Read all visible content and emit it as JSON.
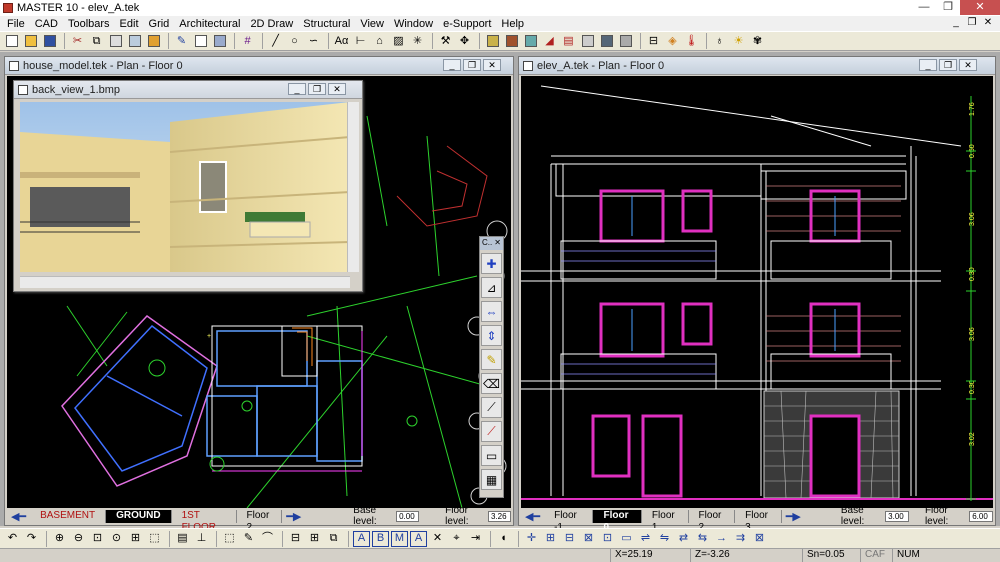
{
  "window": {
    "title": "MASTER 10 - elev_A.tek"
  },
  "menu": [
    "File",
    "CAD",
    "Toolbars",
    "Edit",
    "Grid",
    "Architectural",
    "2D Draw",
    "Structural",
    "View",
    "Window",
    "e-Support",
    "Help"
  ],
  "left_window": {
    "title": "house_model.tek - Plan - Floor 0",
    "floors": [
      "BASEMENT",
      "GROUND",
      "1ST FLOOR",
      "Floor 2"
    ],
    "active_floor": "GROUND",
    "base_level_label": "Base level:",
    "base_level_value": "0.00",
    "floor_level_label": "Floor level:",
    "floor_level_value": "3.26"
  },
  "render_window": {
    "title": "back_view_1.bmp"
  },
  "right_window": {
    "title": "elev_A.tek - Plan - Floor 0",
    "floors": [
      "Floor -1",
      "Floor 0",
      "Floor 1",
      "Floor 2",
      "Floor 3"
    ],
    "active_floor": "Floor 0",
    "base_level_label": "Base level:",
    "base_level_value": "3.00",
    "floor_level_label": "Floor level:",
    "floor_level_value": "6.00",
    "dimension_labels": [
      "1.76",
      "0.50",
      "3.06",
      "0.30",
      "3.06",
      "0.30",
      "3.02"
    ]
  },
  "palette": {
    "title": "C.."
  },
  "status": {
    "x": "X=25.19",
    "z": "Z=-3.26",
    "sn": "Sn=0.05",
    "caf": "CAF",
    "num": "NUM"
  }
}
